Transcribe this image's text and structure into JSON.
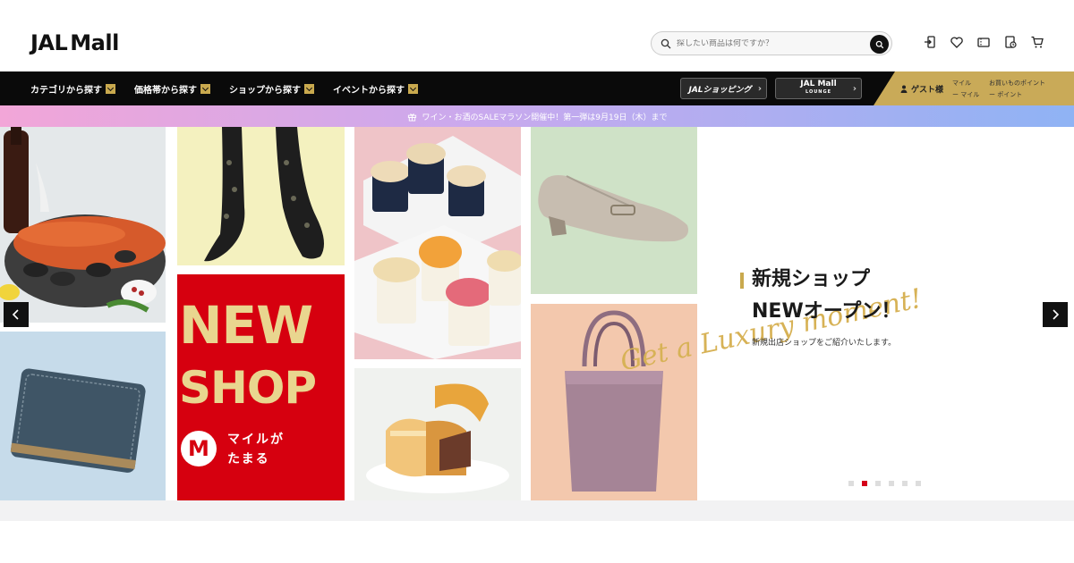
{
  "header": {
    "logo_prefix": "JAL",
    "logo_suffix": "Mall",
    "search_placeholder": "探したい商品は何ですか？"
  },
  "nav": {
    "items": [
      {
        "label": "カテゴリから探す"
      },
      {
        "label": "価格帯から探す"
      },
      {
        "label": "ショップから探す"
      },
      {
        "label": "イベントから探す"
      }
    ],
    "jal_shopping": "JALショッピング",
    "mall_lounge": "JAL Mall",
    "mall_lounge_sub": "LOUNGE",
    "guest": "ゲスト様",
    "mile_label": "マイル",
    "mile_value": "ー マイル",
    "point_label": "お買いものポイント",
    "point_value": "ー ポイント"
  },
  "announcement": "ワイン・お酒のSALEマラソン開催中！第一弾は9月19日（木）まで",
  "hero": {
    "new_shop_line1": "NEW",
    "new_shop_line2": "SHOP",
    "mile_badge": "M",
    "mile_text1": "マイルが",
    "mile_text2": "たまる",
    "script_text": "Get a Luxury moment!",
    "headline1": "新規ショップ",
    "headline2": "NEWオープン！",
    "subtitle": "新規出店ショップをご紹介いたします。",
    "slide_count": 6,
    "active_slide": 2
  },
  "colors": {
    "gold": "#c9a94e",
    "brand_red": "#d4001a",
    "nav_bg": "#0a0a0a"
  }
}
